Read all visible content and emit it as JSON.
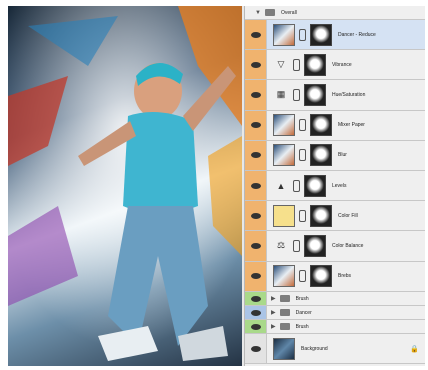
{
  "layers_panel": {
    "group_overall": {
      "name": "Overall"
    },
    "layers": [
      {
        "name": "Dancer - Reduce",
        "type": "smart",
        "selected": true,
        "color": "orange"
      },
      {
        "name": "Vibrance",
        "type": "adjustment",
        "icon": "vibrance-icon",
        "glyph": "▽",
        "color": "orange"
      },
      {
        "name": "Hue/Saturation",
        "type": "adjustment",
        "icon": "hue-saturation-icon",
        "glyph": "▦",
        "color": "orange"
      },
      {
        "name": "Mixer Paper",
        "type": "smart",
        "color": "orange"
      },
      {
        "name": "Blur",
        "type": "smart",
        "color": "orange"
      },
      {
        "name": "Levels",
        "type": "adjustment",
        "icon": "levels-icon",
        "glyph": "▲",
        "color": "orange"
      },
      {
        "name": "Color Fill",
        "type": "fill",
        "fill_color": "#f6e08c",
        "color": "orange"
      },
      {
        "name": "Color Balance",
        "type": "adjustment",
        "icon": "color-balance-icon",
        "glyph": "⚖",
        "color": "orange"
      },
      {
        "name": "Brebs",
        "type": "smart",
        "color": "orange"
      }
    ],
    "groups": [
      {
        "name": "Brush",
        "color": "green"
      },
      {
        "name": "Dancer",
        "color": "blue"
      },
      {
        "name": "Brush",
        "color": "green"
      }
    ],
    "background": {
      "name": "Background"
    }
  }
}
